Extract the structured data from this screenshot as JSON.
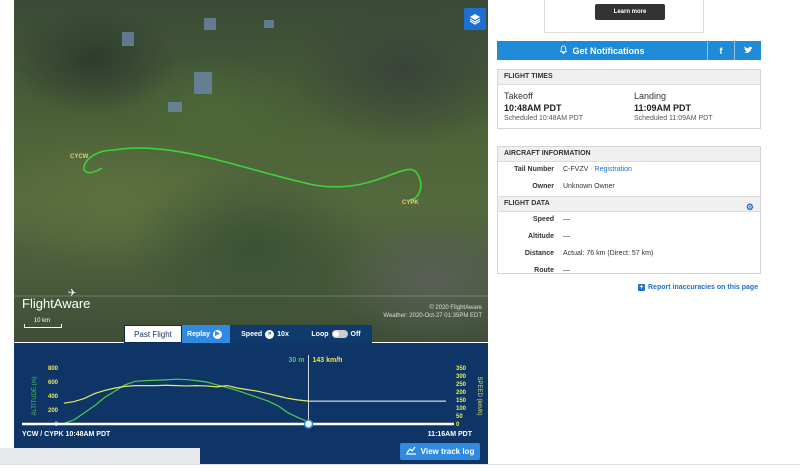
{
  "map": {
    "airport_origin": "CYCW",
    "airport_dest": "CYPK",
    "logo": "FlightAware",
    "scale": "10 km",
    "copyright": "© 2020 FlightAware",
    "weather": "Weather: 2020-Oct-27 01:35PM EDT",
    "layers_icon": "layers-icon"
  },
  "controls": {
    "past_flight": "Past Flight",
    "replay": "Replay",
    "speed_label": "Speed",
    "speed_value": "10x",
    "loop_label": "Loop",
    "loop_state": "Off"
  },
  "chart": {
    "altitude_current": "30 m",
    "speed_current": "143 km/h",
    "route": "YCW / CYPK 10:48AM PDT",
    "end_time": "11:16AM PDT",
    "view_track_log": "View track log"
  },
  "chart_data": {
    "type": "line",
    "xlabel": "",
    "y_left": {
      "label": "ALTITUDE (m)",
      "ticks": [
        0,
        200,
        400,
        600,
        800
      ],
      "ylim": [
        0,
        800
      ]
    },
    "y_right": {
      "label": "SPEED (km/h)",
      "ticks": [
        0,
        50,
        100,
        150,
        200,
        250,
        300,
        350
      ],
      "ylim": [
        0,
        350
      ]
    },
    "series": [
      {
        "name": "Altitude",
        "axis": "left",
        "color": "#4fc94f",
        "values": [
          10,
          60,
          160,
          260,
          380,
          470,
          560,
          610,
          620,
          625,
          630,
          640,
          635,
          620,
          600,
          560,
          520,
          480,
          430,
          380,
          330,
          260,
          160,
          90,
          30
        ]
      },
      {
        "name": "Speed",
        "axis": "right",
        "color": "#e7e95a",
        "values": [
          130,
          140,
          160,
          190,
          210,
          225,
          235,
          240,
          240,
          240,
          242,
          240,
          238,
          240,
          238,
          232,
          240,
          225,
          215,
          205,
          190,
          175,
          160,
          150,
          143
        ]
      }
    ],
    "replay_progress": 0.64
  },
  "ad": {
    "button": "Learn more"
  },
  "notifications": {
    "label": "Get Notifications",
    "facebook": "f",
    "twitter": "t"
  },
  "flight_times": {
    "header": "FLIGHT TIMES",
    "takeoff_label": "Takeoff",
    "takeoff_time": "10:48AM PDT",
    "takeoff_scheduled": "Scheduled 10:48AM PDT",
    "landing_label": "Landing",
    "landing_time": "11:09AM PDT",
    "landing_scheduled": "Scheduled 11:09AM PDT"
  },
  "aircraft": {
    "header": "AIRCRAFT INFORMATION",
    "tail_label": "Tail Number",
    "tail_value": "C-FVZV",
    "tail_sep": "·",
    "registration": "Registration",
    "owner_label": "Owner",
    "owner_value": "Unknown Owner"
  },
  "flight_data": {
    "header": "FLIGHT DATA",
    "speed_label": "Speed",
    "speed_value": "—",
    "altitude_label": "Altitude",
    "altitude_value": "—",
    "distance_label": "Distance",
    "distance_value": "Actual: 76 km (Direct: 57 km)",
    "route_label": "Route",
    "route_value": "—"
  },
  "report_link": "Report inaccuracies on this page"
}
